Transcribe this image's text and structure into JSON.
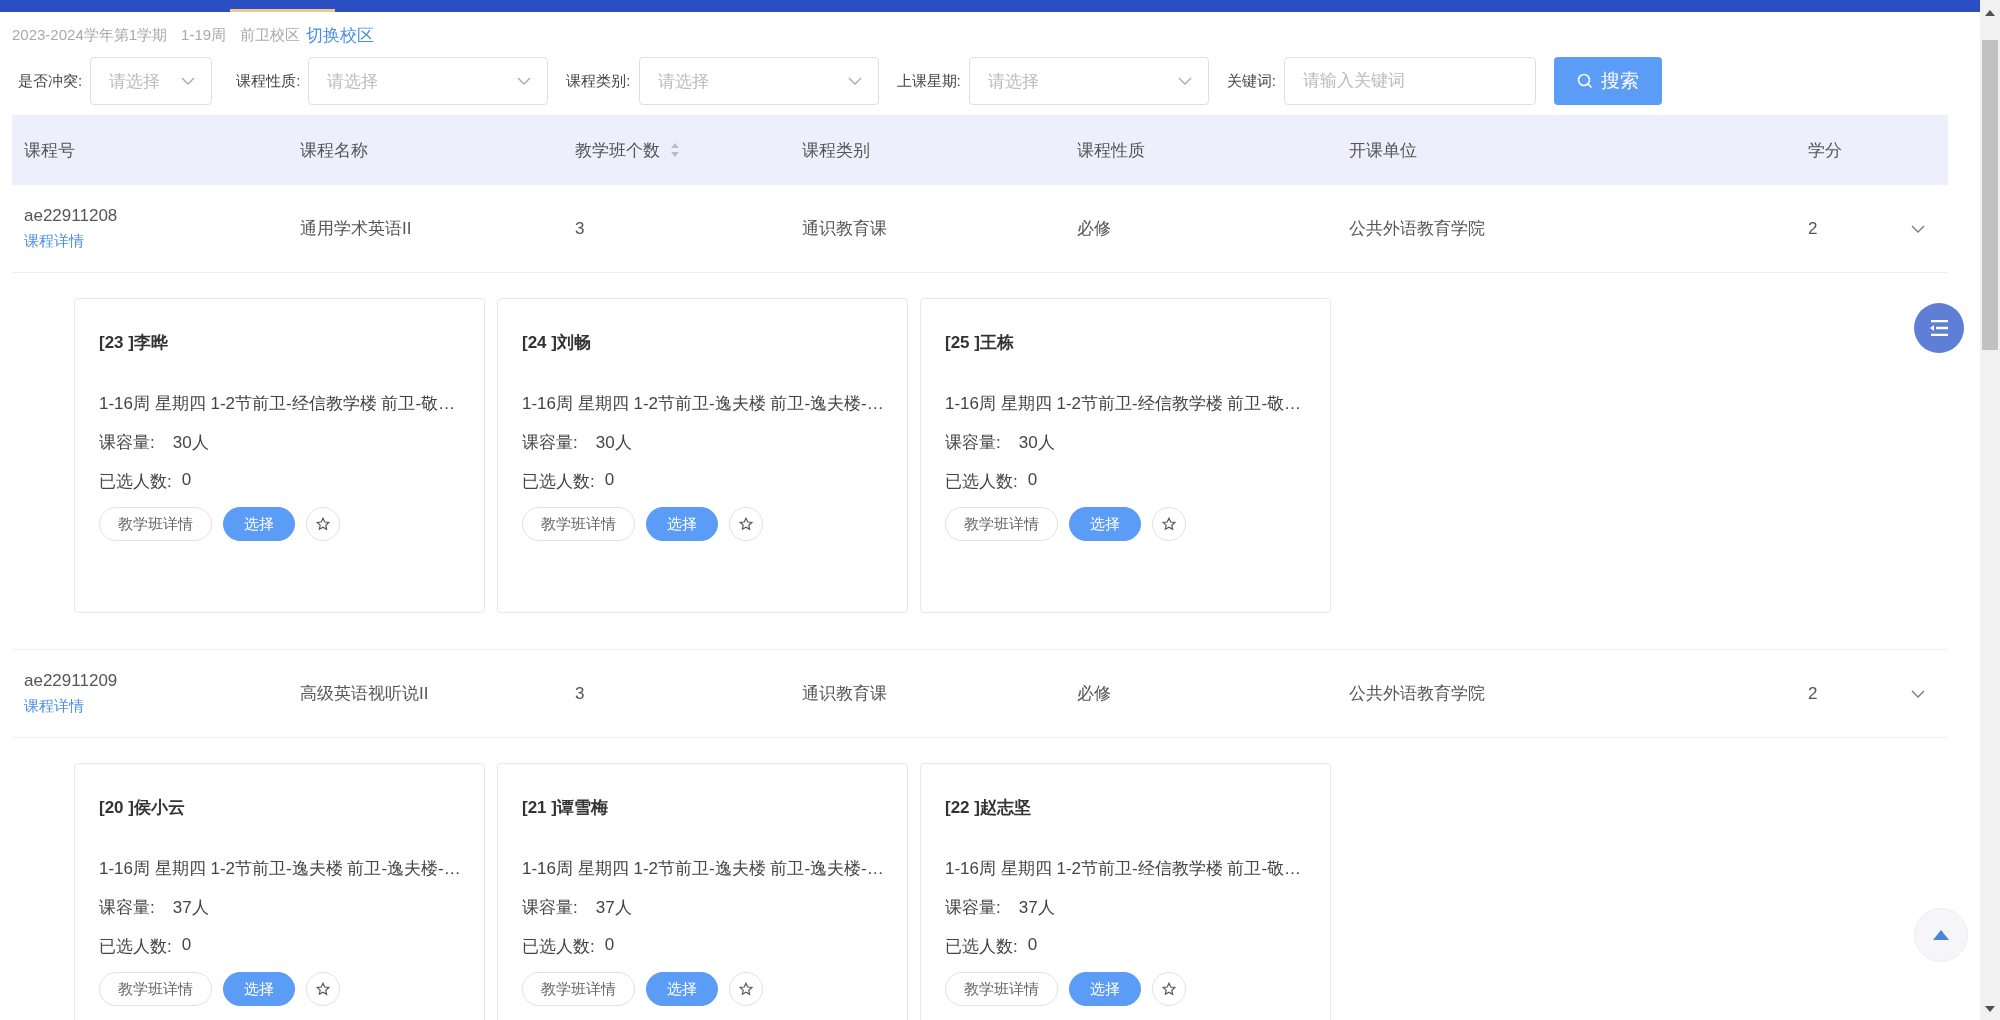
{
  "top_bar": {
    "tabs": [
      {
        "selected": true
      }
    ]
  },
  "info": {
    "term": "2023-2024学年第1学期",
    "weeks": "1-19周",
    "campus": "前卫校区",
    "switch_link": "切换校区"
  },
  "filters": [
    {
      "kind": "select",
      "label": "是否冲突:",
      "placeholder": "请选择"
    },
    {
      "kind": "select",
      "label": "课程性质:",
      "placeholder": "请选择"
    },
    {
      "kind": "select",
      "label": "课程类别:",
      "placeholder": "请选择"
    },
    {
      "kind": "select",
      "label": "上课星期:",
      "placeholder": "请选择"
    },
    {
      "kind": "input",
      "label": "关键词:",
      "placeholder": "请输入关键词"
    }
  ],
  "search_button": "搜索",
  "table": {
    "columns": [
      {
        "label": "课程号",
        "sortable": false
      },
      {
        "label": "课程名称",
        "sortable": false
      },
      {
        "label": "教学班个数",
        "sortable": true
      },
      {
        "label": "课程类别",
        "sortable": false
      },
      {
        "label": "课程性质",
        "sortable": false
      },
      {
        "label": "开课单位",
        "sortable": false
      },
      {
        "label": "学分",
        "sortable": false
      }
    ],
    "rows": [
      {
        "code": "ae22911208",
        "detail_link": "课程详情",
        "name": "通用学术英语II",
        "class_count": "3",
        "category": "通识教育课",
        "nature": "必修",
        "department": "公共外语教育学院",
        "credit": "2",
        "expanded": true,
        "classes": [
          {
            "title": "[23 ]李晔",
            "schedule": "1-16周 星期四 1-2节前卫-经信教学楼 前卫-敬…",
            "capacity_label": "课容量:",
            "capacity": "30人",
            "enrolled_label": "已选人数:",
            "enrolled": "0",
            "detail_button": "教学班详情",
            "select_button": "选择",
            "favorited": false
          },
          {
            "title": "[24 ]刘畅",
            "schedule": "1-16周 星期四 1-2节前卫-逸夫楼 前卫-逸夫楼-…",
            "capacity_label": "课容量:",
            "capacity": "30人",
            "enrolled_label": "已选人数:",
            "enrolled": "0",
            "detail_button": "教学班详情",
            "select_button": "选择",
            "favorited": false
          },
          {
            "title": "[25 ]王栋",
            "schedule": "1-16周 星期四 1-2节前卫-经信教学楼 前卫-敬…",
            "capacity_label": "课容量:",
            "capacity": "30人",
            "enrolled_label": "已选人数:",
            "enrolled": "0",
            "detail_button": "教学班详情",
            "select_button": "选择",
            "favorited": false
          }
        ]
      },
      {
        "code": "ae22911209",
        "detail_link": "课程详情",
        "name": "高级英语视听说II",
        "class_count": "3",
        "category": "通识教育课",
        "nature": "必修",
        "department": "公共外语教育学院",
        "credit": "2",
        "expanded": true,
        "classes": [
          {
            "title": "[20 ]侯小云",
            "schedule": "1-16周 星期四 1-2节前卫-逸夫楼 前卫-逸夫楼-…",
            "capacity_label": "课容量:",
            "capacity": "37人",
            "enrolled_label": "已选人数:",
            "enrolled": "0",
            "detail_button": "教学班详情",
            "select_button": "选择",
            "favorited": false
          },
          {
            "title": "[21 ]谭雪梅",
            "schedule": "1-16周 星期四 1-2节前卫-逸夫楼 前卫-逸夫楼-…",
            "capacity_label": "课容量:",
            "capacity": "37人",
            "enrolled_label": "已选人数:",
            "enrolled": "0",
            "detail_button": "教学班详情",
            "select_button": "选择",
            "favorited": false
          },
          {
            "title": "[22 ]赵志坚",
            "schedule": "1-16周 星期四 1-2节前卫-经信教学楼 前卫-敬…",
            "capacity_label": "课容量:",
            "capacity": "37人",
            "enrolled_label": "已选人数:",
            "enrolled": "0",
            "detail_button": "教学班详情",
            "select_button": "选择",
            "favorited": false
          }
        ]
      }
    ]
  }
}
